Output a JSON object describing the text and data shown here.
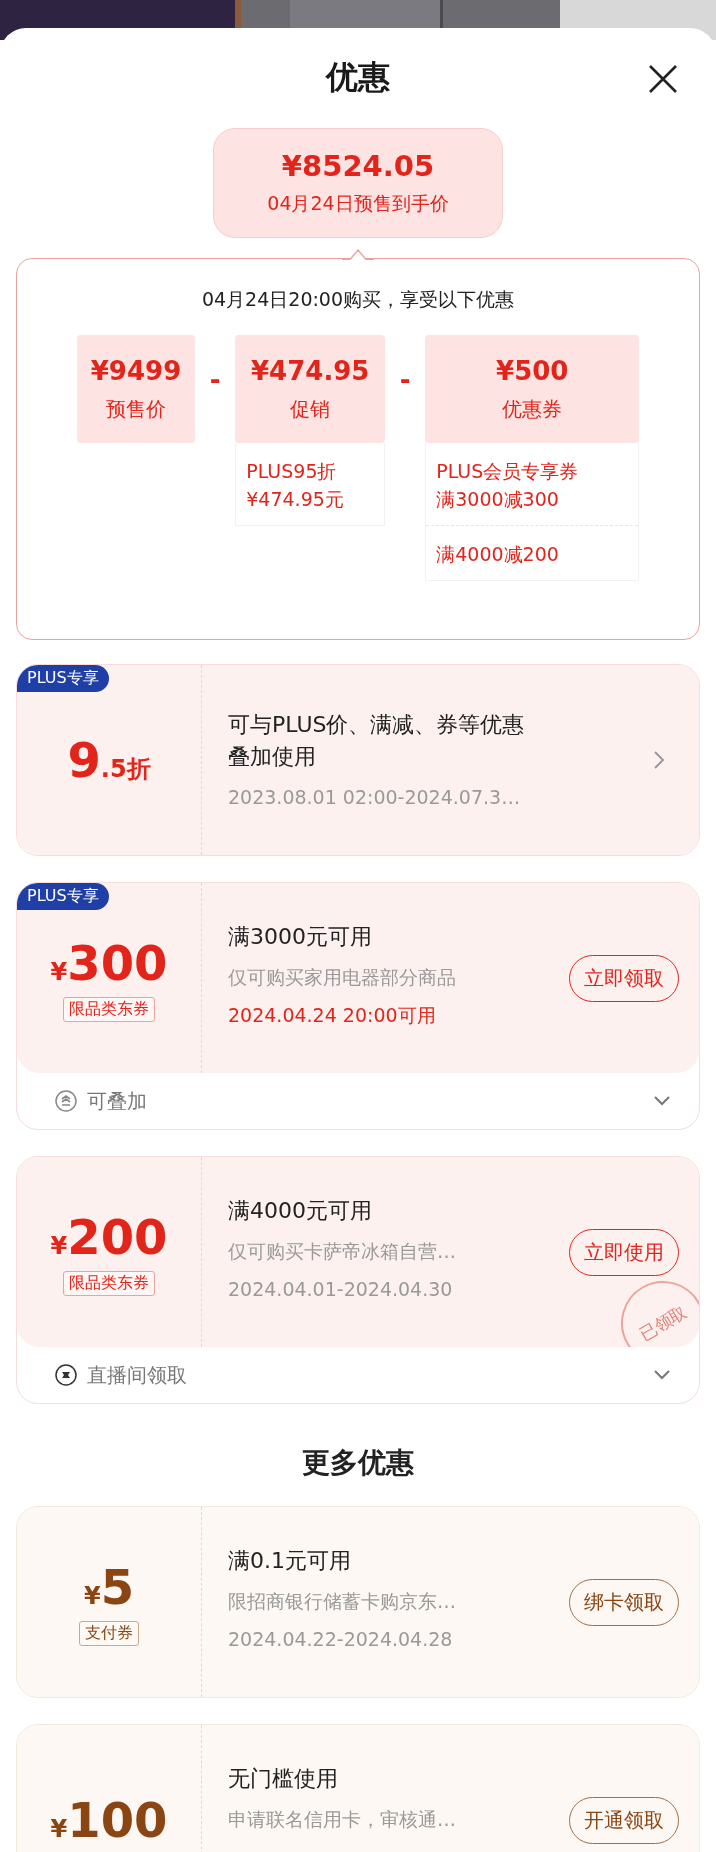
{
  "header": {
    "title": "优惠"
  },
  "price_bubble": {
    "amount": "¥8524.05",
    "label": "04月24日预售到手价"
  },
  "breakdown": {
    "intro": "04月24日20:00购买，享受以下优惠",
    "items": [
      {
        "amount": "¥9499",
        "label": "预售价"
      },
      {
        "operator": "-",
        "amount": "¥474.95",
        "label": "促销",
        "details": [
          [
            "PLUS95折",
            "¥474.95元"
          ]
        ]
      },
      {
        "operator": "-",
        "amount": "¥500",
        "label": "优惠券",
        "details": [
          [
            "PLUS会员专享券",
            "满3000减300"
          ],
          [
            "满4000减200"
          ]
        ]
      }
    ]
  },
  "coupons": [
    {
      "kind": "discount",
      "badge": "PLUS专享",
      "big": "9",
      "small": ".5折",
      "title": "可与PLUS价、满减、券等优惠叠加使用",
      "date": "2023.08.01 02:00-2024.07.3…",
      "date_highlight": false,
      "action": {
        "kind": "chevron"
      }
    },
    {
      "kind": "amount",
      "badge": "PLUS专享",
      "currency": "¥",
      "big": "300",
      "tag": "限品类东券",
      "title": "满3000元可用",
      "desc": "仅可购买家用电器部分商品",
      "date": "2024.04.24 20:00可用",
      "date_highlight": true,
      "action": {
        "kind": "button",
        "label": "立即领取"
      },
      "footer": {
        "text": "可叠加",
        "expanded": false
      }
    },
    {
      "kind": "amount",
      "currency": "¥",
      "big": "200",
      "tag": "限品类东券",
      "title": "满4000元可用",
      "desc": "仅可购买卡萨帝冰箱自营…",
      "date": "2024.04.01-2024.04.30",
      "date_highlight": false,
      "action": {
        "kind": "button",
        "label": "立即使用"
      },
      "stamp": "已领取",
      "footer": {
        "text": "直播间领取",
        "expanded": false
      }
    }
  ],
  "more": {
    "title": "更多优惠",
    "coupons": [
      {
        "kind": "amount",
        "currency": "¥",
        "big": "5",
        "tag": "支付券",
        "title": "满0.1元可用",
        "desc": "限招商银行储蓄卡购京东…",
        "date": "2024.04.22-2024.04.28",
        "date_highlight": false,
        "action": {
          "kind": "button",
          "label": "绑卡领取"
        }
      },
      {
        "kind": "amount",
        "currency": "¥",
        "big": "100",
        "title": "无门槛使用",
        "desc": "申请联名信用卡，审核通…",
        "action": {
          "kind": "button",
          "label": "开通领取"
        }
      }
    ]
  }
}
